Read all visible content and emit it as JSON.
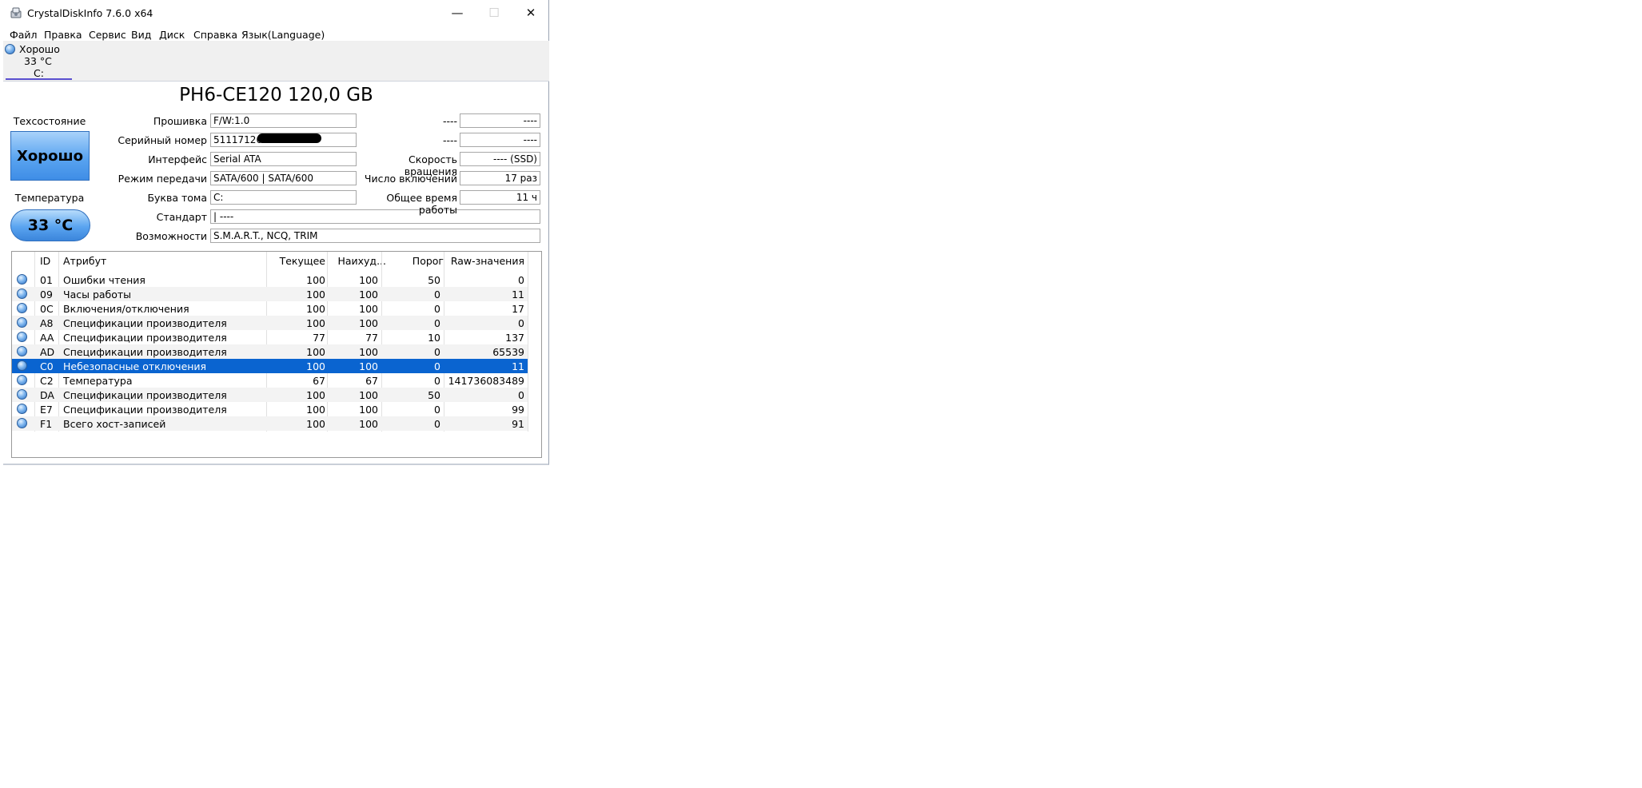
{
  "window": {
    "title": "CrystalDiskInfo 7.6.0 x64"
  },
  "controls": {
    "minimize": "—",
    "maximize": "☐",
    "close": "✕"
  },
  "menu": [
    "Файл",
    "Правка",
    "Сервис",
    "Вид",
    "Диск",
    "Справка",
    "Язык(Language)"
  ],
  "drive_tab": {
    "health": "Хорошо",
    "temperature": "33 °C",
    "letter": "C:"
  },
  "disk": {
    "title": "PH6-CE120 120,0 GB"
  },
  "status": {
    "health_label": "Техсостояние",
    "health_value": "Хорошо",
    "temp_label": "Температура",
    "temp_value": "33 °C"
  },
  "info": {
    "firmware": {
      "label": "Прошивка",
      "value": "F/W:1.0"
    },
    "serial": {
      "label": "Серийный номер",
      "value": "5111712013"
    },
    "interface": {
      "label": "Интерфейс",
      "value": "Serial ATA"
    },
    "transfer": {
      "label": "Режим передачи",
      "value": "SATA/600 | SATA/600"
    },
    "volume": {
      "label": "Буква тома",
      "value": "C:"
    },
    "standard": {
      "label": "Стандарт",
      "value": "| ----"
    },
    "features": {
      "label": "Возможности",
      "value": "S.M.A.R.T., NCQ, TRIM"
    },
    "right1": {
      "label": "----",
      "value": "----"
    },
    "right2": {
      "label": "----",
      "value": "----"
    },
    "rotation": {
      "label": "Скорость вращения",
      "value": "---- (SSD)"
    },
    "power_count": {
      "label": "Число включений",
      "value": "17 раз"
    },
    "power_hours": {
      "label": "Общее время работы",
      "value": "11 ч"
    }
  },
  "table": {
    "headers": {
      "id": "ID",
      "attribute": "Атрибут",
      "current": "Текущее",
      "worst": "Наихуд...",
      "threshold": "Порог",
      "raw": "Raw-значения"
    },
    "rows": [
      {
        "id": "01",
        "attribute": "Ошибки чтения",
        "current": "100",
        "worst": "100",
        "threshold": "50",
        "raw": "0"
      },
      {
        "id": "09",
        "attribute": "Часы работы",
        "current": "100",
        "worst": "100",
        "threshold": "0",
        "raw": "11"
      },
      {
        "id": "0C",
        "attribute": "Включения/отключения",
        "current": "100",
        "worst": "100",
        "threshold": "0",
        "raw": "17"
      },
      {
        "id": "A8",
        "attribute": "Спецификации производителя",
        "current": "100",
        "worst": "100",
        "threshold": "0",
        "raw": "0"
      },
      {
        "id": "AA",
        "attribute": "Спецификации производителя",
        "current": "77",
        "worst": "77",
        "threshold": "10",
        "raw": "137"
      },
      {
        "id": "AD",
        "attribute": "Спецификации производителя",
        "current": "100",
        "worst": "100",
        "threshold": "0",
        "raw": "65539"
      },
      {
        "id": "C0",
        "attribute": "Небезопасные отключения",
        "current": "100",
        "worst": "100",
        "threshold": "0",
        "raw": "11"
      },
      {
        "id": "C2",
        "attribute": "Температура",
        "current": "67",
        "worst": "67",
        "threshold": "0",
        "raw": "141736083489"
      },
      {
        "id": "DA",
        "attribute": "Спецификации производителя",
        "current": "100",
        "worst": "100",
        "threshold": "50",
        "raw": "0"
      },
      {
        "id": "E7",
        "attribute": "Спецификации производителя",
        "current": "100",
        "worst": "100",
        "threshold": "0",
        "raw": "99"
      },
      {
        "id": "F1",
        "attribute": "Всего хост-записей",
        "current": "100",
        "worst": "100",
        "threshold": "0",
        "raw": "91"
      }
    ]
  }
}
